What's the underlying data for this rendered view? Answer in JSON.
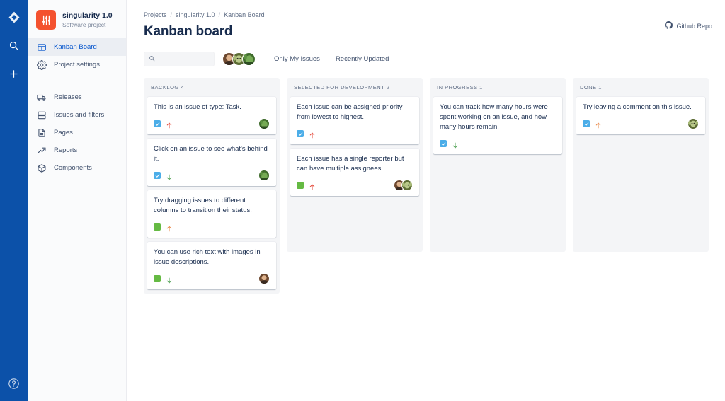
{
  "rail": {
    "logo_icon": "jira-diamond-logo",
    "items": [
      {
        "icon": "search-icon",
        "name": "search"
      },
      {
        "icon": "plus-icon",
        "name": "create"
      }
    ],
    "help_icon": "help-circle-icon",
    "background_color": "#0c51a9"
  },
  "sidebar": {
    "project": {
      "name": "singularity 1.0",
      "type": "Software project",
      "logo_icon": "sliders-icon",
      "logo_color": "#f4522f"
    },
    "items": [
      {
        "label": "Kanban Board",
        "icon": "board-icon",
        "active": true
      },
      {
        "label": "Project settings",
        "icon": "gear-icon",
        "active": false
      },
      {
        "label": "Releases",
        "icon": "truck-icon",
        "active": false
      },
      {
        "label": "Issues and filters",
        "icon": "issues-icon",
        "active": false
      },
      {
        "label": "Pages",
        "icon": "page-icon",
        "active": false
      },
      {
        "label": "Reports",
        "icon": "trend-up-icon",
        "active": false
      },
      {
        "label": "Components",
        "icon": "box-icon",
        "active": false
      }
    ],
    "active_color": "#0052cc"
  },
  "header": {
    "breadcrumb": [
      "Projects",
      "singularity 1.0",
      "Kanban Board"
    ],
    "breadcrumb_separator": "/",
    "title": "Kanban board",
    "github_link": {
      "label": "Github Repo",
      "icon": "github-icon"
    }
  },
  "toolbar": {
    "search": {
      "placeholder": "",
      "value": "",
      "icon": "search-icon"
    },
    "avatars": [
      {
        "name": "avatar-user-1",
        "colors": [
          "#8c5a3c",
          "#d7a98c",
          "#3d2b21"
        ]
      },
      {
        "name": "avatar-user-2",
        "colors": [
          "#9aa85a",
          "#c8d08a",
          "#5b6b33"
        ]
      },
      {
        "name": "avatar-user-3",
        "colors": [
          "#4f7a3a",
          "#7fae5a",
          "#2f4d22"
        ]
      }
    ],
    "filters": [
      {
        "label": "Only My Issues"
      },
      {
        "label": "Recently Updated"
      }
    ]
  },
  "board": {
    "columns": [
      {
        "title": "BACKLOG 4",
        "name": "backlog",
        "cards": [
          {
            "title": "This is an issue of type: Task.",
            "type": "task",
            "type_icon": "task-checkbox-icon",
            "priority": "high",
            "priority_icon": "arrow-up-icon",
            "avatars": [
              {
                "name": "avatar-assignee",
                "colors": [
                  "#4f7a3a",
                  "#7fae5a",
                  "#2f4d22"
                ]
              }
            ]
          },
          {
            "title": "Click on an issue to see what's behind it.",
            "type": "task",
            "type_icon": "task-checkbox-icon",
            "priority": "low",
            "priority_icon": "arrow-down-icon",
            "avatars": [
              {
                "name": "avatar-assignee",
                "colors": [
                  "#4f7a3a",
                  "#7fae5a",
                  "#2f4d22"
                ]
              }
            ]
          },
          {
            "title": "Try dragging issues to different columns to transition their status.",
            "type": "story",
            "type_icon": "story-square-icon",
            "priority": "medium",
            "priority_icon": "arrow-up-icon",
            "avatars": []
          },
          {
            "title": "You can use rich text with images in issue descriptions.",
            "type": "story",
            "type_icon": "story-square-icon",
            "priority": "low",
            "priority_icon": "arrow-down-icon",
            "avatars": [
              {
                "name": "avatar-assignee",
                "colors": [
                  "#8c5a3c",
                  "#d7a98c",
                  "#3d2b21"
                ]
              }
            ]
          }
        ]
      },
      {
        "title": "SELECTED FOR DEVELOPMENT 2",
        "name": "selected-for-development",
        "cards": [
          {
            "title": "Each issue can be assigned priority from lowest to highest.",
            "type": "task",
            "type_icon": "task-checkbox-icon",
            "priority": "high",
            "priority_icon": "arrow-up-icon",
            "avatars": []
          },
          {
            "title": "Each issue has a single reporter but can have multiple assignees.",
            "type": "story",
            "type_icon": "story-square-icon",
            "priority": "high",
            "priority_icon": "arrow-up-icon",
            "avatars": [
              {
                "name": "avatar-assignee-1",
                "colors": [
                  "#8c5a3c",
                  "#d7a98c",
                  "#3d2b21"
                ]
              },
              {
                "name": "avatar-assignee-2",
                "colors": [
                  "#9aa85a",
                  "#c8d08a",
                  "#5b6b33"
                ]
              }
            ]
          }
        ]
      },
      {
        "title": "IN PROGRESS 1",
        "name": "in-progress",
        "cards": [
          {
            "title": "You can track how many hours were spent working on an issue, and how many hours remain.",
            "type": "task",
            "type_icon": "task-checkbox-icon",
            "priority": "low",
            "priority_icon": "arrow-down-icon",
            "avatars": []
          }
        ]
      },
      {
        "title": "DONE 1",
        "name": "done",
        "cards": [
          {
            "title": "Try leaving a comment on this issue.",
            "type": "task",
            "type_icon": "task-checkbox-icon",
            "priority": "medium",
            "priority_icon": "arrow-up-icon",
            "avatars": [
              {
                "name": "avatar-assignee",
                "colors": [
                  "#9aa85a",
                  "#c8d08a",
                  "#5b6b33"
                ]
              }
            ]
          }
        ]
      }
    ]
  },
  "colors": {
    "task": "#4bade8",
    "story": "#65ba43",
    "priority_high": "#e5493a",
    "priority_medium": "#e9894a",
    "priority_low": "#57a55a",
    "text": "#172b4d",
    "subtle": "#5e6c84"
  }
}
